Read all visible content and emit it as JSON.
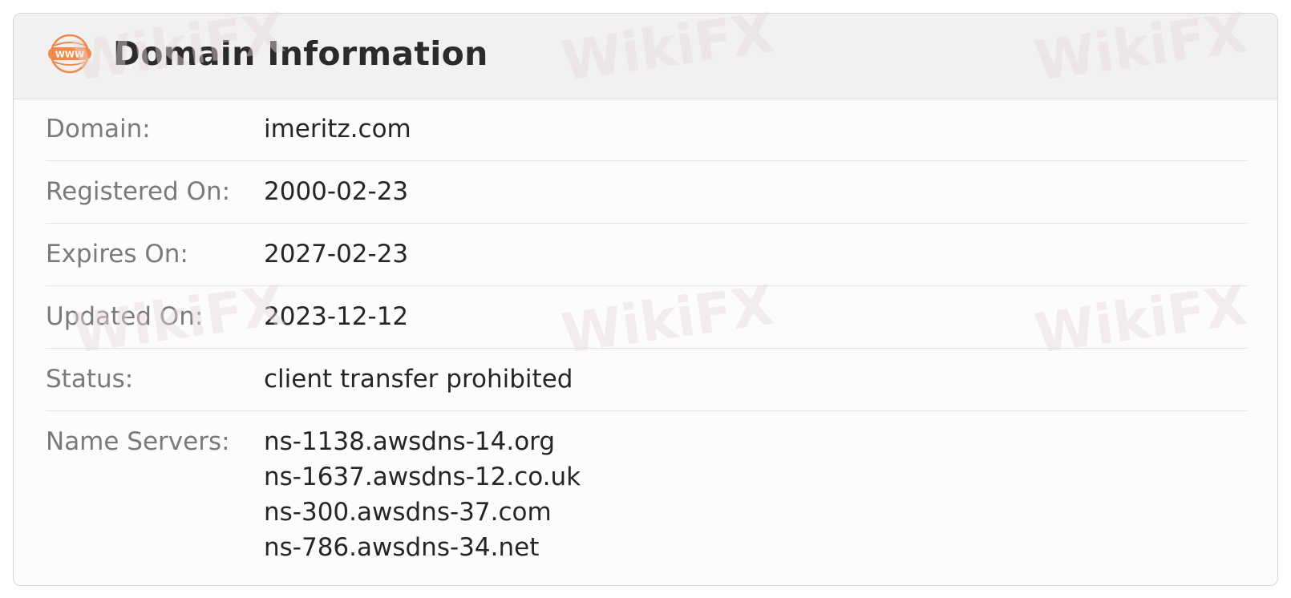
{
  "header": {
    "title": "Domain Information",
    "icon": "www-globe-icon",
    "icon_text": "WWW",
    "accent_color": "#f08a4b"
  },
  "rows": [
    {
      "label": "Domain:",
      "value": "imeritz.com"
    },
    {
      "label": "Registered On:",
      "value": "2000-02-23"
    },
    {
      "label": "Expires On:",
      "value": "2027-02-23"
    },
    {
      "label": "Updated On:",
      "value": "2023-12-12"
    },
    {
      "label": "Status:",
      "value": "client transfer prohibited"
    }
  ],
  "name_servers": {
    "label": "Name Servers:",
    "values": [
      "ns-1138.awsdns-14.org",
      "ns-1637.awsdns-12.co.uk",
      "ns-300.awsdns-37.com",
      "ns-786.awsdns-34.net"
    ]
  },
  "watermark": {
    "text": "WikiFX"
  }
}
